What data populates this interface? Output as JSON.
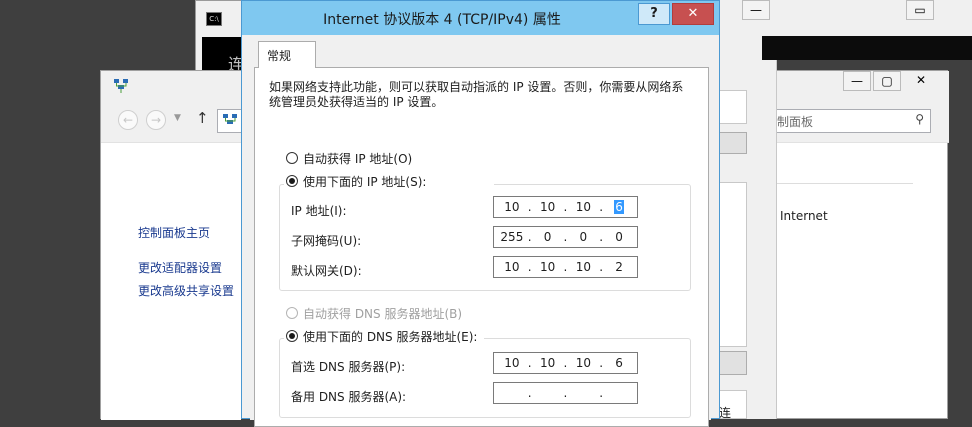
{
  "cmd_window": {
    "console_text": "连"
  },
  "network_window": {
    "search_placeholder": "制面板",
    "sidebar": {
      "home": "控制面板主页",
      "adapter_settings": "更改适配器设置",
      "advanced_sharing": "更改高级共享设置"
    },
    "connection_label": "Internet",
    "bottom_text": "连"
  },
  "dialog": {
    "title": "Internet 协议版本 4 (TCP/IPv4) 属性",
    "help_label": "?",
    "close_label": "✕",
    "tab_general": "常规",
    "description": "如果网络支持此功能，则可以获取自动指派的 IP 设置。否则，你需要从网络系统管理员处获得适当的 IP 设置。",
    "auto_ip_label": "自动获得 IP 地址(O)",
    "manual_ip_label": "使用下面的 IP 地址(S):",
    "ip_address_label": "IP 地址(I):",
    "subnet_label": "子网掩码(U):",
    "gateway_label": "默认网关(D):",
    "ip_address": [
      "10",
      "10",
      "10",
      "6"
    ],
    "subnet_mask": [
      "255",
      "0",
      "0",
      "0"
    ],
    "gateway": [
      "10",
      "10",
      "10",
      "2"
    ],
    "auto_dns_label": "自动获得 DNS 服务器地址(B)",
    "manual_dns_label": "使用下面的 DNS 服务器地址(E):",
    "preferred_dns_label": "首选 DNS 服务器(P):",
    "alternate_dns_label": "备用 DNS 服务器(A):",
    "preferred_dns": [
      "10",
      "10",
      "10",
      "6"
    ],
    "alternate_dns": [
      "",
      "",
      "",
      ""
    ],
    "selected": {
      "ip_mode": "manual",
      "dns_mode": "manual"
    }
  },
  "colors": {
    "titlebar": "#7fc8f0",
    "close_button": "#c75050",
    "selection": "#3399ff"
  }
}
